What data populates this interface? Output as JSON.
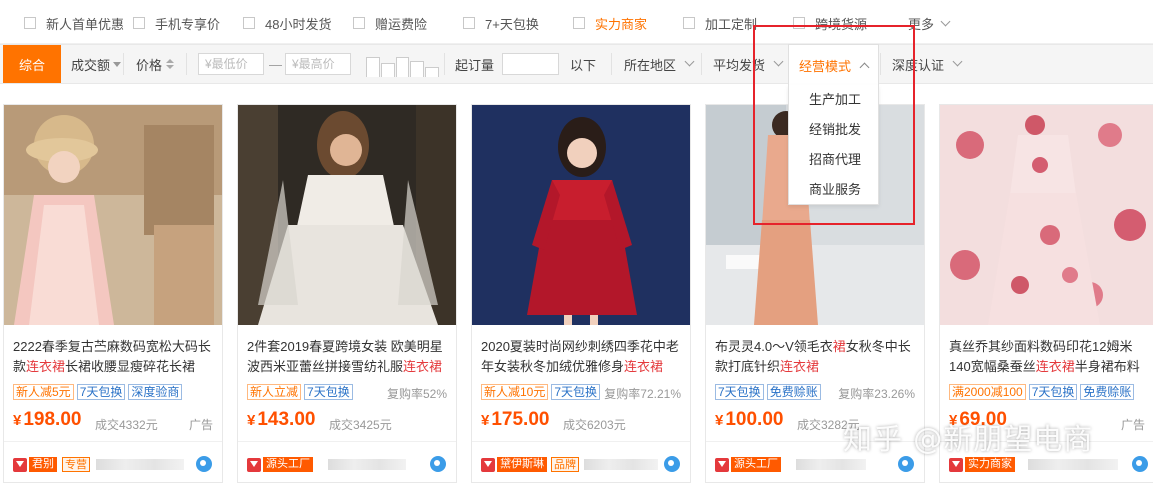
{
  "filters": {
    "items": [
      {
        "label": "新人首单优惠",
        "highlight": false
      },
      {
        "label": "手机专享价",
        "highlight": false
      },
      {
        "label": "48小时发货",
        "highlight": false
      },
      {
        "label": "赠运费险",
        "highlight": false
      },
      {
        "label": "7+天包换",
        "highlight": false
      },
      {
        "label": "实力商家",
        "highlight": true
      },
      {
        "label": "加工定制",
        "highlight": false
      },
      {
        "label": "跨境货源",
        "highlight": false
      }
    ],
    "more_label": "更多"
  },
  "sort_bar": {
    "comprehensive": "综合",
    "deal_volume": "成交额",
    "price": "价格",
    "min_price_placeholder": "¥最低价",
    "dash": "—",
    "max_price_placeholder": "¥最高价",
    "moq_label": "起订量",
    "below_label": "以下",
    "region": "所在地区",
    "avg_ship": "平均发货",
    "business_mode": "经营模式",
    "deep_cert": "深度认证"
  },
  "business_mode_menu": [
    "生产加工",
    "经销批发",
    "招商代理",
    "商业服务"
  ],
  "products": [
    {
      "title_a": "2222春季复古苎麻数码宽松大码长款",
      "keyword": "连衣裙",
      "title_b": "长裙收腰显瘦碎花长裙",
      "tags": [
        {
          "text": "新人减5元",
          "color": "orange"
        },
        {
          "text": "7天包换",
          "color": "blue"
        },
        {
          "text": "深度验商",
          "color": "blue"
        }
      ],
      "repurchase": "",
      "price": "198.00",
      "deals": "成交4332元",
      "ad": "广告",
      "badge": "君别",
      "badge2": "专营"
    },
    {
      "title_a": "2件套2019春夏跨境女装 欧美明星波西米亚蕾丝拼接雪纺礼服",
      "keyword": "连衣裙",
      "title_b": "",
      "tags": [
        {
          "text": "新人立减",
          "color": "orange"
        },
        {
          "text": "7天包换",
          "color": "blue"
        }
      ],
      "repurchase": "复购率52%",
      "price": "143.00",
      "deals": "成交3425元",
      "ad": "",
      "badge": "源头工厂",
      "badge2": ""
    },
    {
      "title_a": "2020夏装时尚网纱刺绣四季花中老年女装秋冬加绒优雅修身",
      "keyword": "连衣裙",
      "title_b": "",
      "tags": [
        {
          "text": "新人减10元",
          "color": "orange"
        },
        {
          "text": "7天包换",
          "color": "blue"
        }
      ],
      "repurchase": "复购率72.21%",
      "price": "175.00",
      "deals": "成交6203元",
      "ad": "",
      "badge": "黛伊斯琳",
      "badge2": "品牌"
    },
    {
      "title_a": "布灵灵4.0～V领毛衣",
      "keyword": "裙",
      "title_b": "女秋冬中长款打底针织",
      "keyword2": "连衣裙",
      "tags": [
        {
          "text": "7天包换",
          "color": "blue"
        },
        {
          "text": "免费赊账",
          "color": "blue"
        }
      ],
      "repurchase": "复购率23.26%",
      "price": "100.00",
      "deals": "成交3282元",
      "ad": "",
      "badge": "源头工厂",
      "badge2": ""
    },
    {
      "title_a": "真丝乔其纱面料数码印花12姆米140宽幅桑蚕丝",
      "keyword": "连衣裙",
      "title_b": "半身裙布料",
      "tags": [
        {
          "text": "满2000减100",
          "color": "orange"
        },
        {
          "text": "7天包换",
          "color": "blue"
        },
        {
          "text": "免费赊账",
          "color": "blue"
        }
      ],
      "repurchase": "",
      "price": "69.00",
      "deals": "",
      "ad": "广告",
      "badge": "实力商家",
      "badge2": ""
    }
  ],
  "currency_symbol": "¥",
  "watermark": "知乎 @新朋望电商"
}
